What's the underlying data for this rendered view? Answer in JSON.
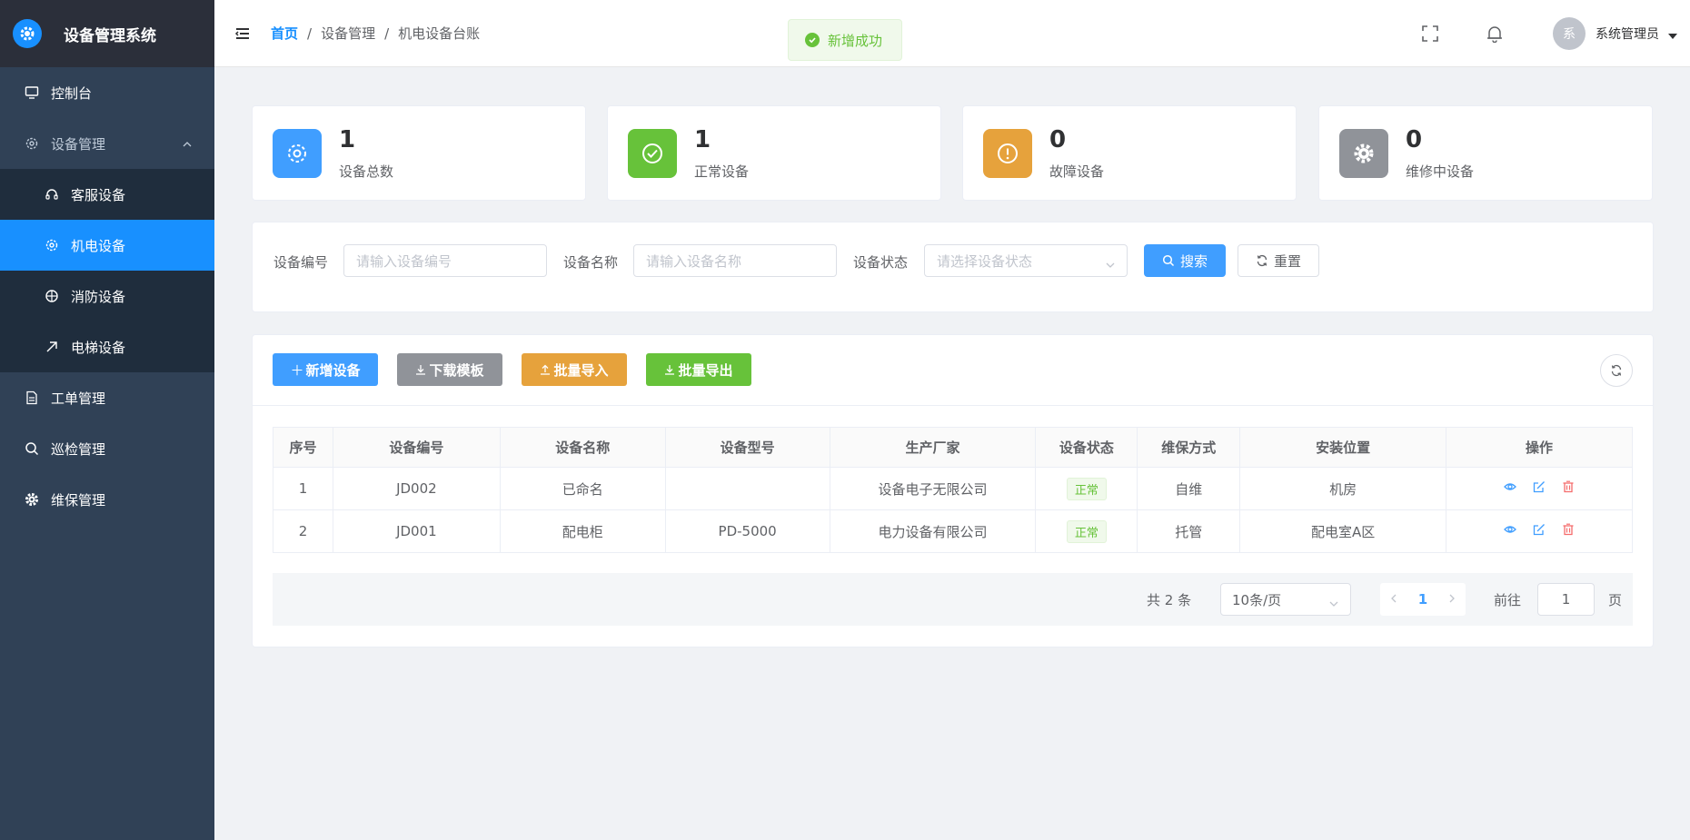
{
  "app": {
    "title": "设备管理系统"
  },
  "sidebar": {
    "items": [
      {
        "label": "控制台"
      },
      {
        "label": "设备管理"
      },
      {
        "label": "客服设备"
      },
      {
        "label": "机电设备"
      },
      {
        "label": "消防设备"
      },
      {
        "label": "电梯设备"
      },
      {
        "label": "工单管理"
      },
      {
        "label": "巡检管理"
      },
      {
        "label": "维保管理"
      }
    ]
  },
  "header": {
    "breadcrumb": [
      "首页",
      "设备管理",
      "机电设备台账"
    ],
    "breadcrumb_sep": "/",
    "toast": "新增成功",
    "avatar_text": "系",
    "user_name": "系统管理员"
  },
  "stats": [
    {
      "value": "1",
      "label": "设备总数",
      "color": "#409eff"
    },
    {
      "value": "1",
      "label": "正常设备",
      "color": "#67c23a"
    },
    {
      "value": "0",
      "label": "故障设备",
      "color": "#e6a23c"
    },
    {
      "value": "0",
      "label": "维修中设备",
      "color": "#909399"
    }
  ],
  "search": {
    "code_label": "设备编号",
    "code_placeholder": "请输入设备编号",
    "name_label": "设备名称",
    "name_placeholder": "请输入设备名称",
    "status_label": "设备状态",
    "status_placeholder": "请选择设备状态",
    "search_btn": "搜索",
    "reset_btn": "重置"
  },
  "toolbar": {
    "add": "新增设备",
    "download": "下载模板",
    "import": "批量导入",
    "export": "批量导出"
  },
  "table": {
    "headers": [
      "序号",
      "设备编号",
      "设备名称",
      "设备型号",
      "生产厂家",
      "设备状态",
      "维保方式",
      "安装位置",
      "操作"
    ],
    "rows": [
      {
        "no": "1",
        "code": "JD002",
        "name": "已命名",
        "model": "",
        "maker": "设备电子无限公司",
        "status": "正常",
        "maint": "自维",
        "location": "机房"
      },
      {
        "no": "2",
        "code": "JD001",
        "name": "配电柜",
        "model": "PD-5000",
        "maker": "电力设备有限公司",
        "status": "正常",
        "maint": "托管",
        "location": "配电室A区"
      }
    ]
  },
  "pagination": {
    "total": "共 2 条",
    "page_size": "10条/页",
    "current": "1",
    "goto_label": "前往",
    "goto_value": "1",
    "page_unit": "页"
  },
  "colors": {
    "primary": "#1890ff",
    "sidebar_bg": "#304156",
    "success": "#67c23a",
    "warning": "#e6a23c",
    "info": "#909399",
    "danger": "#f56c6c"
  }
}
